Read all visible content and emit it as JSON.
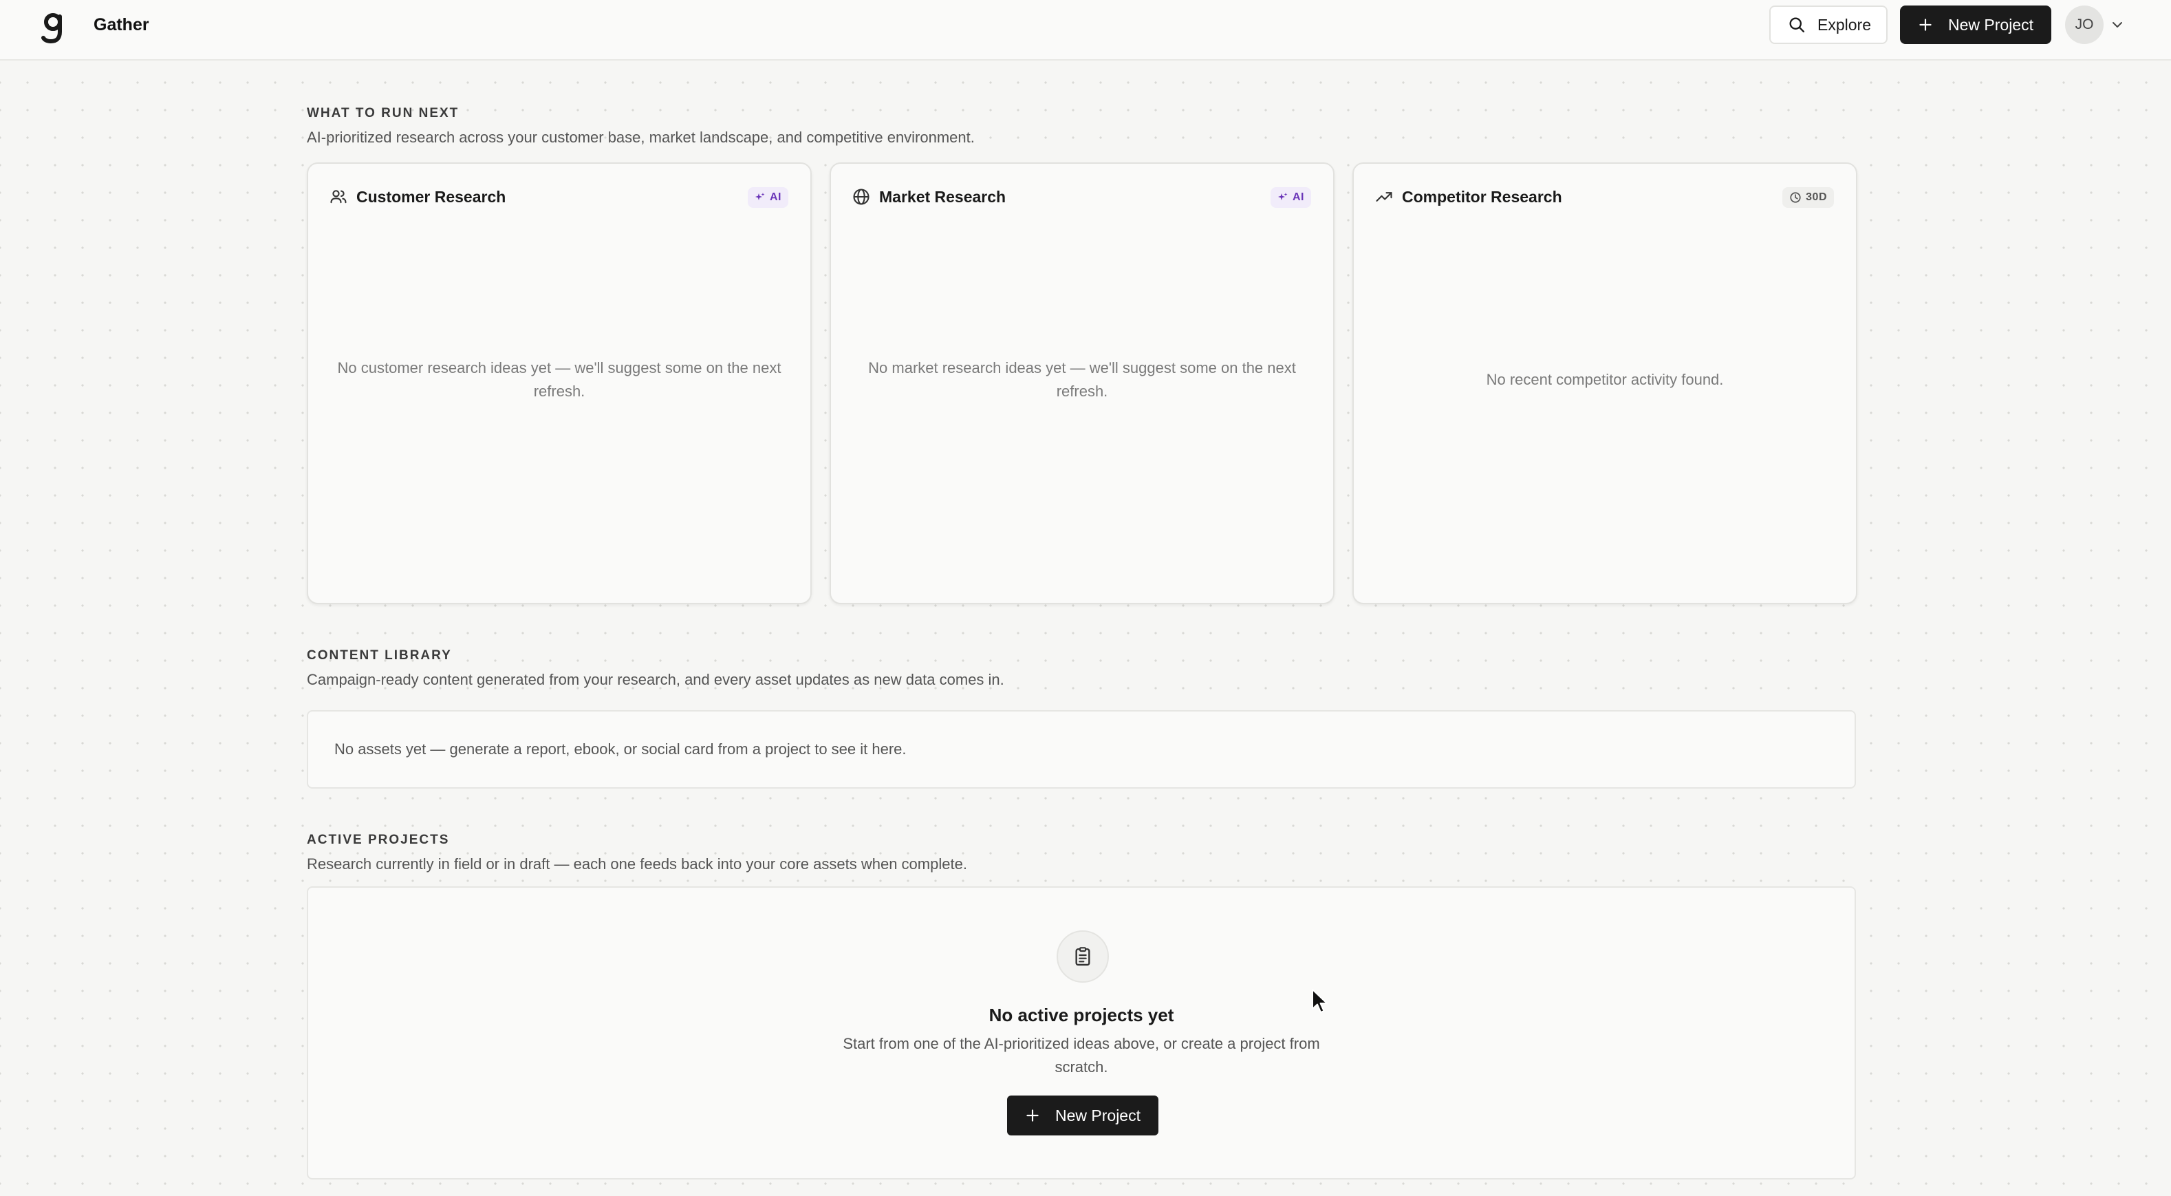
{
  "app": {
    "name": "Gather",
    "logo_icon": "gather-g-logo"
  },
  "header": {
    "explore_label": "Explore",
    "new_project_label": "New Project",
    "avatar_initials": "JO"
  },
  "what_to_run_next": {
    "kicker": "WHAT TO RUN NEXT",
    "description": "AI-prioritized research across your customer base, market landscape, and competitive environment.",
    "cards": [
      {
        "title": "Customer Research",
        "icon": "users-icon",
        "badge": "AI",
        "empty_text": "No customer research ideas yet — we'll suggest some on the next refresh."
      },
      {
        "title": "Market Research",
        "icon": "globe-icon",
        "badge": "AI",
        "empty_text": "No market research ideas yet — we'll suggest some on the next refresh."
      },
      {
        "title": "Competitor Research",
        "icon": "trending-up-icon",
        "badge": "30D",
        "empty_text": "No recent competitor activity found."
      }
    ]
  },
  "content_library": {
    "kicker": "CONTENT LIBRARY",
    "description": "Campaign-ready content generated from your research, and every asset updates as new data comes in.",
    "empty_text": "No assets yet — generate a report, ebook, or social card from a project to see it here."
  },
  "active_projects": {
    "kicker": "ACTIVE PROJECTS",
    "description": "Research currently in field or in draft — each one feeds back into your core assets when complete.",
    "empty_title": "No active projects yet",
    "empty_text": "Start from one of the AI-prioritized ideas above, or create a project from scratch.",
    "new_project_label": "New Project"
  },
  "colors": {
    "primary_button": "#1b1b1b",
    "ai_badge_text": "#6a35b8",
    "ai_badge_bg": "#f1ecfa",
    "page_background": "#f6f6f4"
  }
}
